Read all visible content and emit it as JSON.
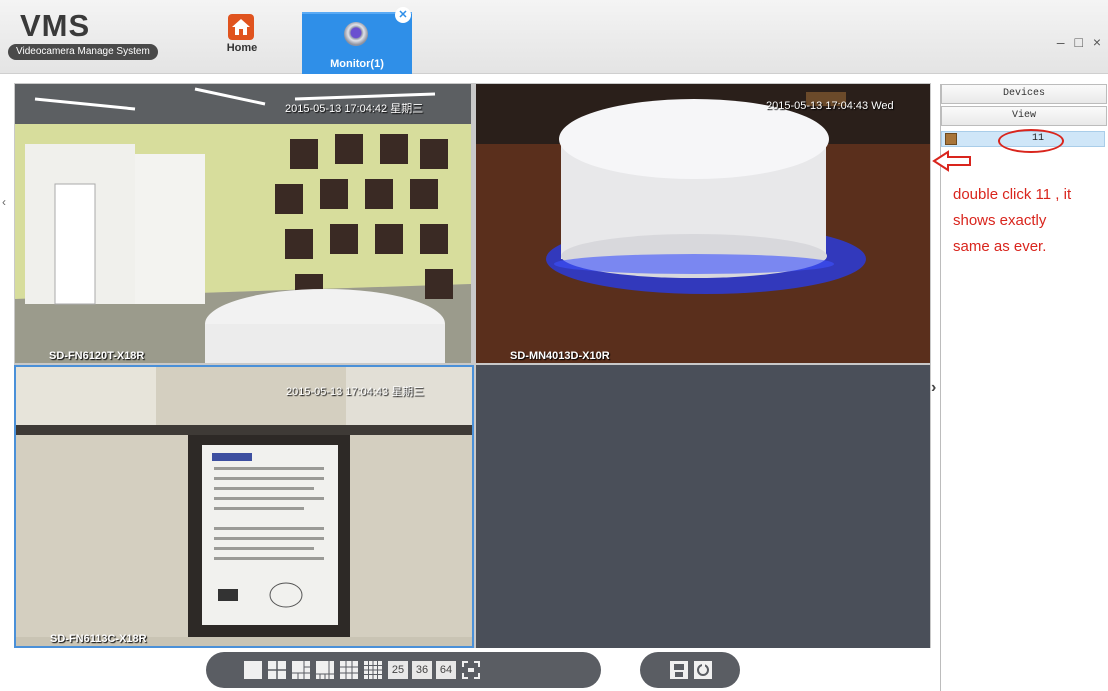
{
  "window": {
    "logo_title": "VMS",
    "logo_subtitle": "Videocamera Manage System",
    "controls": "– □ ×"
  },
  "nav": {
    "home_label": "Home",
    "monitor_tab_label": "Monitor(1)",
    "close_glyph": "✕"
  },
  "cameras": [
    {
      "timestamp": "2015-05-13 17:04:42 星期三",
      "name": "SD-FN6120T-X18R"
    },
    {
      "timestamp": "2015-05-13 17:04:43 Wed",
      "name": "SD-MN4013D-X10R"
    },
    {
      "timestamp": "2015-05-13 17:04:43 星期三",
      "name": "SD-FN6113C-X18R"
    }
  ],
  "toolbar": {
    "layout_buttons": [
      "1",
      "4",
      "6",
      "8",
      "9",
      "16"
    ],
    "layout_numbers": [
      "25",
      "36",
      "64"
    ],
    "icons": [
      "single-view-icon",
      "quad-view-icon",
      "six-view-icon",
      "eight-view-icon",
      "nine-view-icon",
      "sixteen-view-icon",
      "fullscreen-icon",
      "save-icon",
      "refresh-icon"
    ]
  },
  "side_panel": {
    "devices_tab": "Devices",
    "view_tab": "View",
    "tree_item_label": "11"
  },
  "annotation": {
    "line1": "double click 11 , it",
    "line2": "shows exactly",
    "line3": "same as ever.",
    "color": "#d9251d"
  },
  "colors": {
    "accent": "#2f8fe8",
    "selected_cell_border": "#4a90d8",
    "empty_cell": "#4a4f59"
  }
}
